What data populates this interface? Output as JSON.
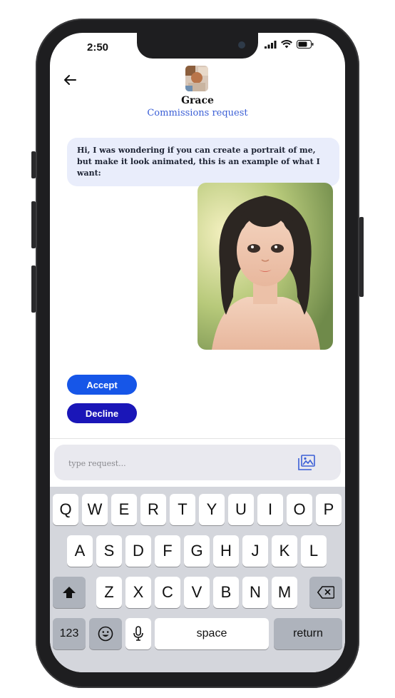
{
  "status": {
    "time": "2:50"
  },
  "header": {
    "name": "Grace",
    "subtitle": "Commissions request"
  },
  "message": {
    "text": "Hi, I was wondering if you can create a portrait of me, but make it look animated, this is an example of what I want:"
  },
  "actions": {
    "accept": "Accept",
    "decline": "Decline"
  },
  "composer": {
    "placeholder": "type request..."
  },
  "keyboard": {
    "row1": [
      "Q",
      "W",
      "E",
      "R",
      "T",
      "Y",
      "U",
      "I",
      "O",
      "P"
    ],
    "row2": [
      "A",
      "S",
      "D",
      "F",
      "G",
      "H",
      "J",
      "K",
      "L"
    ],
    "row3": [
      "Z",
      "X",
      "C",
      "V",
      "B",
      "N",
      "M"
    ],
    "numbers": "123",
    "space": "space",
    "return": "return"
  },
  "colors": {
    "accent": "#3b5fd6",
    "accept": "#1656e8",
    "decline": "#1a16b8",
    "bubble": "#e9edfb"
  }
}
